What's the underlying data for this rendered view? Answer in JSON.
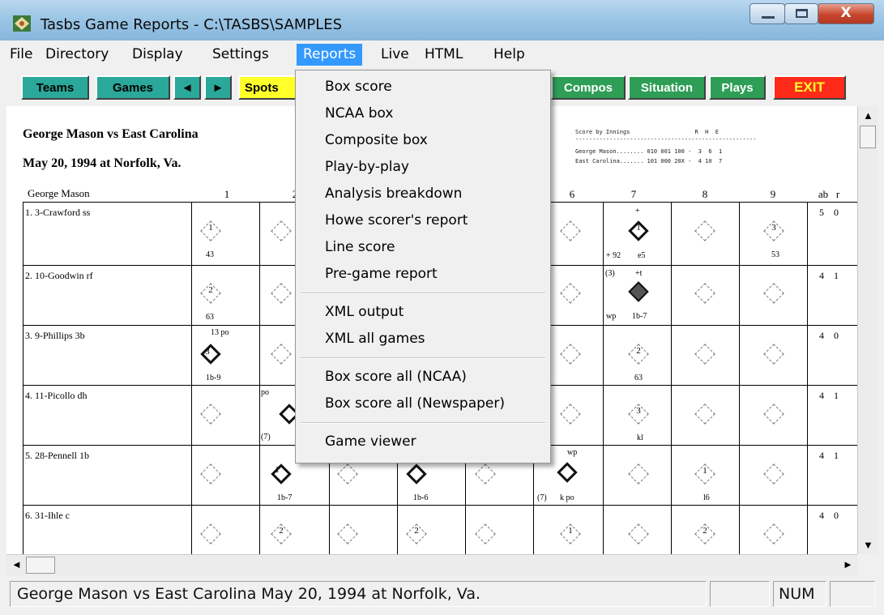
{
  "window": {
    "title": "Tasbs Game Reports - C:\\TASBS\\SAMPLES",
    "close_symbol": "X"
  },
  "menubar": {
    "items": [
      "File",
      "Directory",
      "Display",
      "Settings",
      "Reports",
      "Live",
      "HTML",
      "Help"
    ],
    "active": "Reports"
  },
  "toolbar": {
    "teams": "Teams",
    "games": "Games",
    "prev_icon": "◄",
    "next_icon": "►",
    "spots": "Spots",
    "compos": "Compos",
    "situation": "Situation",
    "plays": "Plays",
    "exit": "EXIT",
    "colors": {
      "teal": "#2aa89a",
      "yellow": "#ffff2a",
      "green": "#2e9e56",
      "red": "#ff2a1a"
    }
  },
  "reports_menu": {
    "items": [
      "Box score",
      "NCAA box",
      "Composite box",
      "Play-by-play",
      "Analysis breakdown",
      "Howe scorer's report",
      "Line score",
      "Pre-game report",
      "XML output",
      "XML all games",
      "Box score all (NCAA)",
      "Box score all (Newspaper)",
      "Game viewer"
    ]
  },
  "scorecard": {
    "matchup": "George Mason vs East Carolina",
    "date_place": "May 20, 1994 at Norfolk, Va.",
    "team_header": "George Mason",
    "innings": [
      "1",
      "2",
      "6",
      "7",
      "8",
      "9"
    ],
    "stat_headers": [
      "ab",
      "r"
    ],
    "line_score": {
      "title": "Score by Innings",
      "rhe": "R  H  E",
      "rows": [
        "George Mason........ 010 001 100 -  3  6  1",
        "East Carolina....... 101 000 20X -  4 10  7"
      ]
    },
    "players": [
      {
        "num": "1.",
        "name": "3-Crawford ss",
        "ab": "5",
        "r": "0"
      },
      {
        "num": "2.",
        "name": "10-Goodwin rf",
        "ab": "4",
        "r": "1"
      },
      {
        "num": "3.",
        "name": "9-Phillips 3b",
        "ab": "4",
        "r": "0"
      },
      {
        "num": "4.",
        "name": "11-Picollo dh",
        "ab": "4",
        "r": "1"
      },
      {
        "num": "5.",
        "name": "28-Pennell 1b",
        "ab": "4",
        "r": "1"
      },
      {
        "num": "6.",
        "name": "31-Ihle c",
        "ab": "4",
        "r": "0"
      }
    ],
    "cell_notes": {
      "r1c1_num": "1",
      "r1c1_txt": "43",
      "r1c7_plus": "+",
      "r1c7_num": "1",
      "r1c7_a": "+ 92",
      "r1c7_b": "e5",
      "r1c9_num": "3",
      "r1c9_txt": "53",
      "r2c1_num": "2",
      "r2c1_txt": "63",
      "r2c7_a": "(3)",
      "r2c7_b": "+t",
      "r2c7_c": "wp",
      "r2c7_d": "1b-7",
      "r3c1_top": "13 po",
      "r3c1_num": "3",
      "r3c1_txt": "1b-9",
      "r3c7_num": "2",
      "r3c7_txt": "63",
      "r4c2_a": "po",
      "r4c2_b": "(7)",
      "r4c7_num": "3",
      "r4c7_txt": "kl",
      "r5c2_num": "1",
      "r5c2_txt": "1b-7",
      "r5c4_txt": "1b-6",
      "r5c6_top": "wp",
      "r5c6_a": "(7)",
      "r5c6_b": "k po",
      "r5c8_num": "1",
      "r5c8_txt": "l6",
      "r6c2_num": "2",
      "r6c4_num": "2",
      "r6c6_num": "1",
      "r6c8_num": "2"
    }
  },
  "statusbar": {
    "text": "George Mason vs East Carolina  May 20, 1994 at Norfolk, Va.",
    "num": "NUM"
  }
}
